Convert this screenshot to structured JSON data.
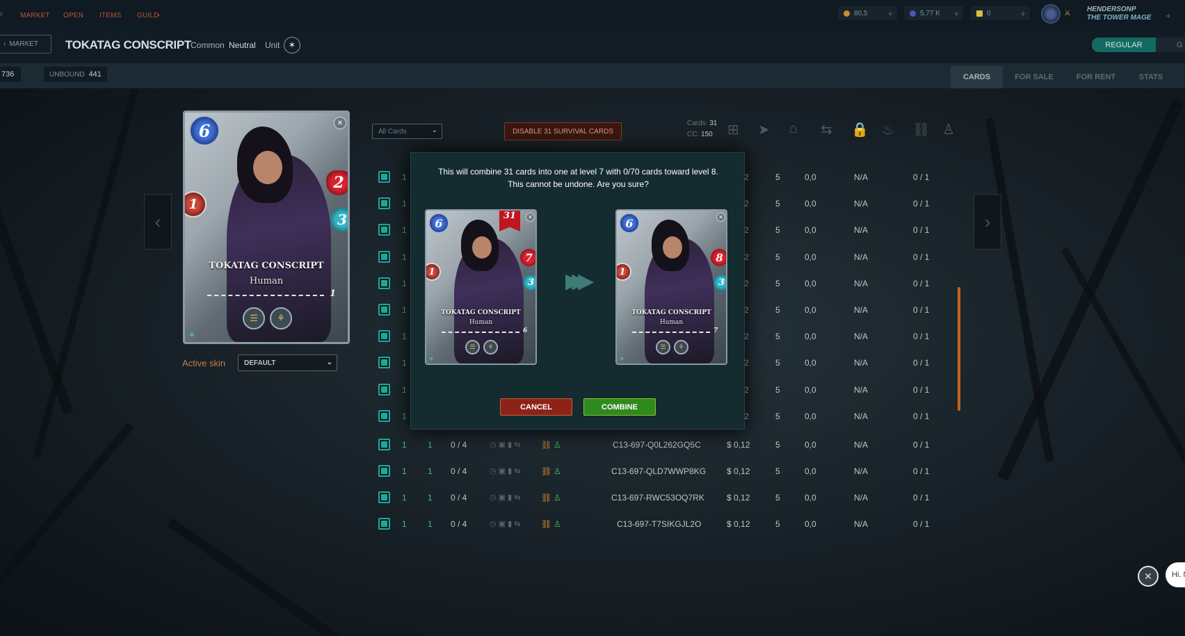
{
  "nav": {
    "partial_left": "P",
    "items": [
      "MARKET",
      "OPEN",
      "ITEMS",
      "GUILD"
    ],
    "guild_dot": "•"
  },
  "resources": [
    {
      "name": "dec",
      "value": "80,5",
      "color": "#d08a2a"
    },
    {
      "name": "sps",
      "value": "5,77 K",
      "color": "#4a55c9"
    },
    {
      "name": "vouchers",
      "value": "0",
      "color": "#d9c04a"
    }
  ],
  "user": {
    "name": "HENDERSONP",
    "title": "THE TOWER MAGE"
  },
  "header": {
    "back_label": "MARKET",
    "card_name": "TOKATAG CONSCRIPT",
    "rarity": "Common",
    "element": "Neutral",
    "type": "Unit",
    "mode_regular": "REGULAR",
    "mode_gold": "G"
  },
  "subbar": {
    "count_partial": "736",
    "unbound_label": "UNBOUND",
    "unbound_value": "441",
    "tabs": [
      "CARDS",
      "FOR SALE",
      "FOR RENT",
      "STATS"
    ],
    "active_tab": "CARDS"
  },
  "main_card": {
    "mana": "6",
    "attack": "1",
    "health": "2",
    "speed": "3",
    "name": "TOKATAG CONSCRIPT",
    "race": "Human",
    "level": "1"
  },
  "skin": {
    "label": "Active skin",
    "value": "DEFAULT"
  },
  "toolbar": {
    "filter": "All Cards",
    "disable_label": "DISABLE 31 SURVIVAL CARDS",
    "cards_label": "Cards:",
    "cards_value": "31",
    "cc_label": "CC:",
    "cc_value": "150"
  },
  "table_rows_hidden": [
    {
      "c1": "1",
      "a": "2",
      "b": "5",
      "c": "0,0",
      "d": "N/A",
      "e": "0 / 1"
    },
    {
      "c1": "1",
      "a": "2",
      "b": "5",
      "c": "0,0",
      "d": "N/A",
      "e": "0 / 1"
    },
    {
      "c1": "1",
      "a": "2",
      "b": "5",
      "c": "0,0",
      "d": "N/A",
      "e": "0 / 1"
    },
    {
      "c1": "1",
      "a": "2",
      "b": "5",
      "c": "0,0",
      "d": "N/A",
      "e": "0 / 1"
    },
    {
      "c1": "1",
      "a": "2",
      "b": "5",
      "c": "0,0",
      "d": "N/A",
      "e": "0 / 1"
    },
    {
      "c1": "1",
      "a": "2",
      "b": "5",
      "c": "0,0",
      "d": "N/A",
      "e": "0 / 1"
    },
    {
      "c1": "1",
      "a": "2",
      "b": "5",
      "c": "0,0",
      "d": "N/A",
      "e": "0 / 1"
    },
    {
      "c1": "1",
      "a": "2",
      "b": "5",
      "c": "0,0",
      "d": "N/A",
      "e": "0 / 1"
    },
    {
      "c1": "1",
      "a": "2",
      "b": "5",
      "c": "0,0",
      "d": "N/A",
      "e": "0 / 1"
    },
    {
      "c1": "1",
      "a": "2",
      "b": "5",
      "c": "0,0",
      "d": "N/A",
      "e": "0 / 1"
    }
  ],
  "table_rows": [
    {
      "c1": "1",
      "level": "1",
      "xp": "0 / 4",
      "uid": "C13-697-Q0L262GQ5C",
      "price": "$ 0,12",
      "b": "5",
      "c": "0,0",
      "d": "N/A",
      "e": "0 / 1"
    },
    {
      "c1": "1",
      "level": "1",
      "xp": "0 / 4",
      "uid": "C13-697-QLD7WWP8KG",
      "price": "$ 0,12",
      "b": "5",
      "c": "0,0",
      "d": "N/A",
      "e": "0 / 1"
    },
    {
      "c1": "1",
      "level": "1",
      "xp": "0 / 4",
      "uid": "C13-697-RWC53OQ7RK",
      "price": "$ 0,12",
      "b": "5",
      "c": "0,0",
      "d": "N/A",
      "e": "0 / 1"
    },
    {
      "c1": "1",
      "level": "1",
      "xp": "0 / 4",
      "uid": "C13-697-T7SIKGJL2O",
      "price": "$ 0,12",
      "b": "5",
      "c": "0,0",
      "d": "N/A",
      "e": "0 / 1"
    }
  ],
  "modal": {
    "line1": "This will combine 31 cards into one at level 7 with 0/70 cards toward level 8.",
    "line2": "This cannot be undone. Are you sure?",
    "from_card": {
      "mana": "6",
      "attack": "1",
      "health": "7",
      "speed": "3",
      "name": "TOKATAG CONSCRIPT",
      "race": "Human",
      "level": "6",
      "count": "31"
    },
    "to_card": {
      "mana": "6",
      "attack": "1",
      "health": "8",
      "speed": "3",
      "name": "TOKATAG CONSCRIPT",
      "race": "Human",
      "level": "7"
    },
    "cancel_label": "CANCEL",
    "combine_label": "COMBINE"
  },
  "chat": {
    "bubble_text": "Hi. N"
  }
}
